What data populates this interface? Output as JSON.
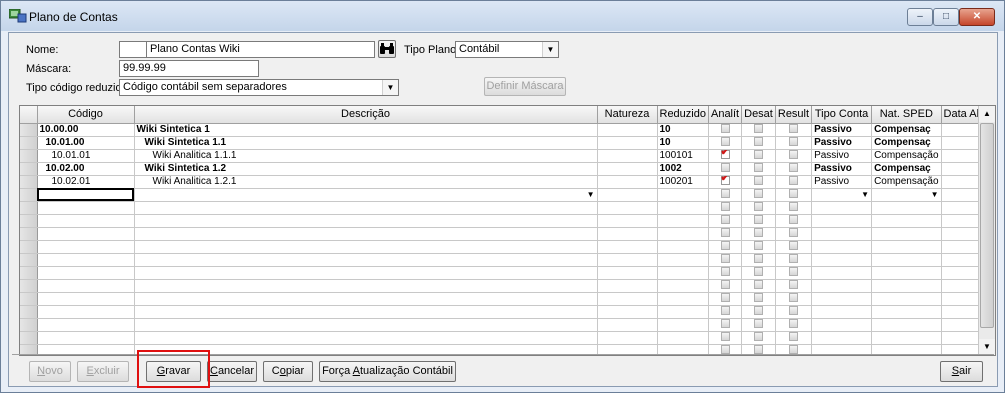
{
  "window": {
    "title": "Plano de Contas",
    "controls": [
      "–",
      "□",
      "✕"
    ]
  },
  "form": {
    "nome_label": "Nome:",
    "nome_code": "",
    "nome_value": "Plano Contas Wiki",
    "search_icon": "binoculars-icon",
    "tipo_plano_label": "Tipo Plano:",
    "tipo_plano_value": "Contábil",
    "mascara_label": "Máscara:",
    "mascara_value": "99.99.99",
    "tipo_codigo_label": "Tipo código reduzido:",
    "tipo_codigo_value": "Código contábil sem separadores",
    "definir_mascara_label": "Definir Máscara"
  },
  "grid": {
    "columns": [
      "Código",
      "Descrição",
      "Natureza",
      "Reduzido",
      "Analít",
      "Desat",
      "Result",
      "Tipo Conta",
      "Nat. SPED",
      "Data Alt."
    ],
    "rows": [
      {
        "codigo": "10.00.00",
        "descricao": "Wiki Sintetica 1",
        "natureza": "",
        "reduzido": "10",
        "analit": false,
        "desat": false,
        "result": false,
        "tipo_conta": "Passivo",
        "nat_sped": "Compensaç",
        "data_alt": "",
        "bold": true,
        "indent": 0
      },
      {
        "codigo": "10.01.00",
        "descricao": "Wiki Sintetica 1.1",
        "natureza": "",
        "reduzido": "10",
        "analit": false,
        "desat": false,
        "result": false,
        "tipo_conta": "Passivo",
        "nat_sped": "Compensaç",
        "data_alt": "",
        "bold": true,
        "indent": 1
      },
      {
        "codigo": "10.01.01",
        "descricao": "Wiki Analitica 1.1.1",
        "natureza": "",
        "reduzido": "100101",
        "analit": true,
        "desat": false,
        "result": false,
        "tipo_conta": "Passivo",
        "nat_sped": "Compensação",
        "data_alt": "",
        "bold": false,
        "indent": 2
      },
      {
        "codigo": "10.02.00",
        "descricao": "Wiki Sintetica 1.2",
        "natureza": "",
        "reduzido": "1002",
        "analit": false,
        "desat": false,
        "result": false,
        "tipo_conta": "Passivo",
        "nat_sped": "Compensaç",
        "data_alt": "",
        "bold": true,
        "indent": 1
      },
      {
        "codigo": "10.02.01",
        "descricao": "Wiki Analitica 1.2.1",
        "natureza": "",
        "reduzido": "100201",
        "analit": true,
        "desat": false,
        "result": false,
        "tipo_conta": "Passivo",
        "nat_sped": "Compensação",
        "data_alt": "",
        "bold": false,
        "indent": 2
      }
    ],
    "empty_rows": 16
  },
  "buttons": {
    "novo": "Novo",
    "excluir": "Excluir",
    "gravar": "Gravar",
    "cancelar": "Cancelar",
    "copiar": "Copiar",
    "forca": "Força Atualização Contábil",
    "sair": "Sair"
  },
  "colors": {
    "highlight": "#e01010",
    "check": "#d01818"
  }
}
